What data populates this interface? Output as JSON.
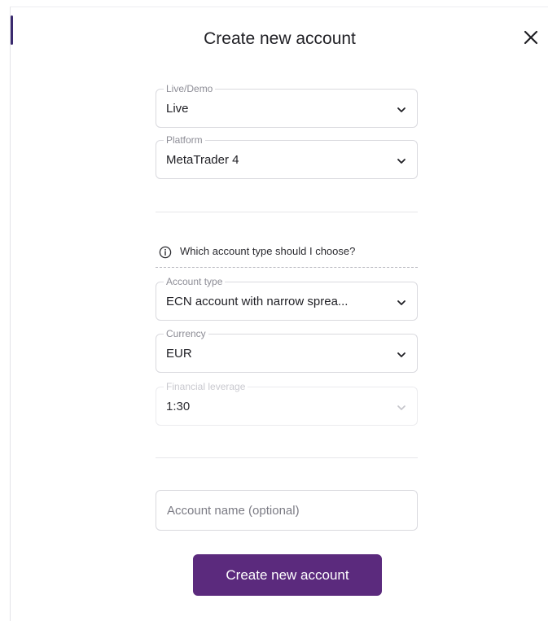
{
  "dialog": {
    "title": "Create new account",
    "close_icon": "close-icon"
  },
  "fields": {
    "live_demo": {
      "label": "Live/Demo",
      "value": "Live"
    },
    "platform": {
      "label": "Platform",
      "value": "MetaTrader 4"
    },
    "account_type": {
      "label": "Account type",
      "value": "ECN account with narrow sprea..."
    },
    "currency": {
      "label": "Currency",
      "value": "EUR"
    },
    "leverage": {
      "label": "Financial leverage",
      "value": "1:30",
      "disabled": true
    }
  },
  "help": {
    "text": "Which account type should I choose?",
    "icon": "info-icon"
  },
  "account_name": {
    "placeholder": "Account name (optional)",
    "value": ""
  },
  "submit": {
    "label": "Create new account"
  },
  "colors": {
    "accent": "#5b2a7d",
    "border": "#d9d9de",
    "text": "#1f1f24",
    "muted": "#8d8d96"
  }
}
